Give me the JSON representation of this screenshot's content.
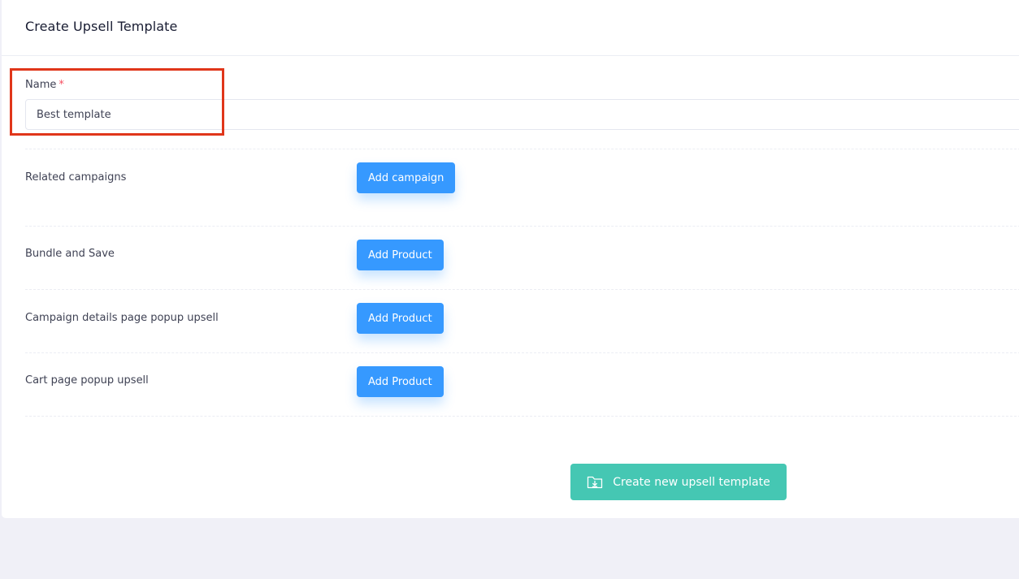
{
  "header": {
    "title": "Create Upsell Template"
  },
  "form": {
    "name": {
      "label": "Name",
      "required_mark": "*",
      "value": "Best template"
    },
    "rows": [
      {
        "label": "Related campaigns",
        "button": "Add campaign"
      },
      {
        "label": "Bundle and Save",
        "button": "Add Product"
      },
      {
        "label": "Campaign details page popup upsell",
        "button": "Add Product"
      },
      {
        "label": "Cart page popup upsell",
        "button": "Add Product"
      }
    ],
    "submit": {
      "label": "Create new upsell template",
      "icon": "folder-download-icon"
    }
  },
  "colors": {
    "primary": "#3699ff",
    "success": "#45c7b3",
    "required": "#f64e60",
    "highlight": "#e0361a"
  }
}
